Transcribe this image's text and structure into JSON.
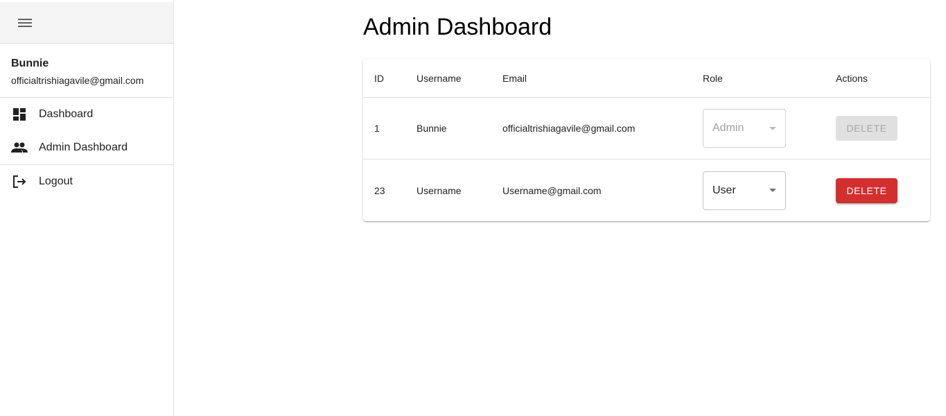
{
  "sidebar": {
    "menu_icon": "hamburger-menu-icon",
    "user": {
      "name": "Bunnie",
      "email": "officialtrishiagavile@gmail.com"
    },
    "nav": [
      {
        "label": "Dashboard",
        "icon": "dashboard-icon"
      },
      {
        "label": "Admin Dashboard",
        "icon": "people-icon"
      }
    ],
    "logout": {
      "label": "Logout",
      "icon": "logout-icon"
    }
  },
  "main": {
    "title": "Admin Dashboard",
    "table": {
      "headers": [
        "ID",
        "Username",
        "Email",
        "Role",
        "Actions"
      ],
      "rows": [
        {
          "id": "1",
          "username": "Bunnie",
          "email": "officialtrishiagavile@gmail.com",
          "role": "Admin",
          "action": "DELETE",
          "disabled": true
        },
        {
          "id": "23",
          "username": "Username",
          "email": "Username@gmail.com",
          "role": "User",
          "action": "DELETE",
          "disabled": false
        }
      ]
    }
  },
  "colors": {
    "danger": "#d32f2f",
    "sidebar_header_bg": "#f5f5f5",
    "divider": "#e0e0e0"
  }
}
